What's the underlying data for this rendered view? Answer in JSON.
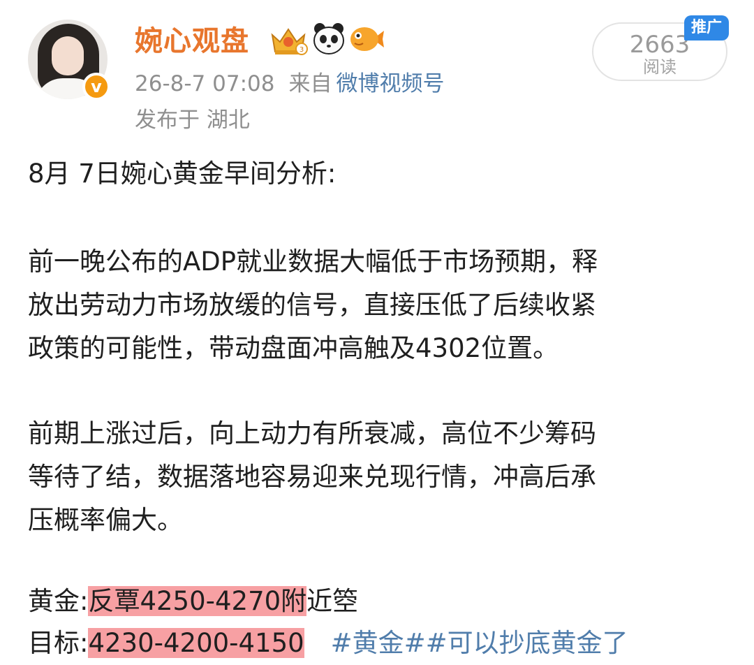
{
  "post": {
    "author": {
      "name": "婉心观盘",
      "avatar_icon": "user-avatar",
      "verified_badge": "v",
      "badge_icons": [
        "crown-icon",
        "panda-icon",
        "fish-icon"
      ]
    },
    "timestamp": "26-8-7 07:08",
    "from_label": "来自",
    "source": "微博视频号",
    "location": "发布于 湖北",
    "stats": {
      "read_count": "2663",
      "read_label": "阅读"
    },
    "ad_badge": "推广",
    "content": {
      "title": "8月 7日婉心黄金早间分析:",
      "para1": [
        "前一晚公布的ADP就业数据大幅低于市场预期，释",
        "放出劳动力市场放缓的信号，直接压低了后续收紧",
        "政策的可能性，带动盘面冲高触及4302位置。"
      ],
      "para2": [
        "前期上涨过后，向上动力有所衰减，高位不少筹码",
        "等待了结，数据落地容易迎来兑现行情，冲高后承",
        "压概率偏大。"
      ],
      "strategy_label": "黄金:",
      "strategy_highlight": "反覃4250-4270附",
      "strategy_tail": "近箜",
      "target_label": "目标:",
      "target_highlight": "4230-4200-4150",
      "hashtags": "#黄金##可以抄底黄金了"
    },
    "colors": {
      "username": "#e8762d",
      "link": "#507dab",
      "highlight": "#f7a0a3",
      "ad_badge": "#2f88e6"
    }
  }
}
